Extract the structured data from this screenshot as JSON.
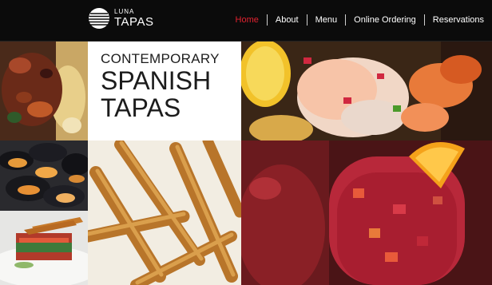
{
  "brand": {
    "small": "LUNA",
    "big": "TAPAS"
  },
  "nav": {
    "items": [
      {
        "label": "Home",
        "active": true
      },
      {
        "label": "About",
        "active": false
      },
      {
        "label": "Menu",
        "active": false
      },
      {
        "label": "Online Ordering",
        "active": false
      },
      {
        "label": "Reservations",
        "active": false
      }
    ]
  },
  "hero": {
    "line1": "CONTEMPORARY",
    "line2": "SPANISH",
    "line3": "TAPAS"
  },
  "colors": {
    "accent": "#e32230",
    "header_bg": "#0b0b0b",
    "hero_bg": "#ffffff"
  },
  "images": [
    {
      "name": "stew-photo"
    },
    {
      "name": "shrimp-photo"
    },
    {
      "name": "mussels-photo"
    },
    {
      "name": "churros-photo"
    },
    {
      "name": "sangria-photo"
    },
    {
      "name": "plated-dish-photo"
    }
  ]
}
